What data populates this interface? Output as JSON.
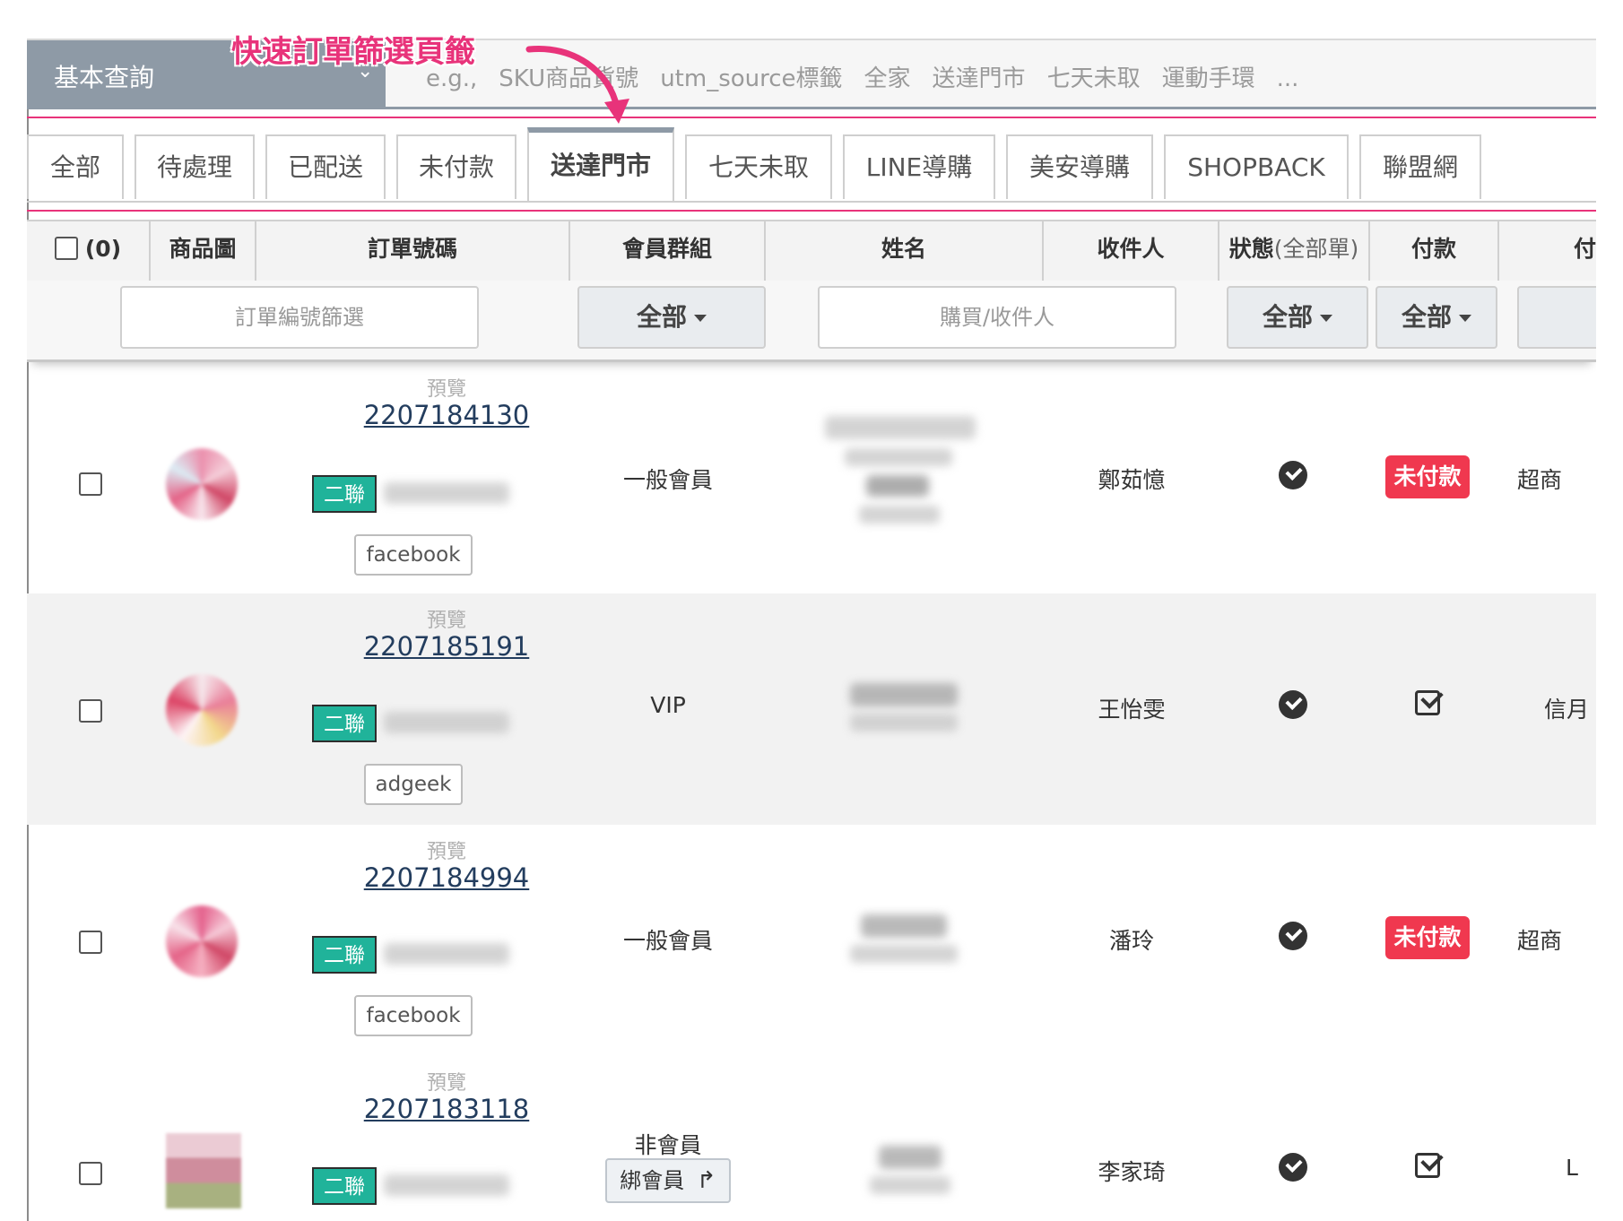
{
  "search": {
    "query_type": "基本查詢",
    "hints": [
      "e.g.,",
      "SKU商品貨號",
      "utm_source標籤",
      "全家",
      "送達門市",
      "七天未取",
      "運動手環",
      "..."
    ]
  },
  "annotation": "快速訂單篩選頁籤",
  "tabs": [
    {
      "label": "全部"
    },
    {
      "label": "待處理"
    },
    {
      "label": "已配送"
    },
    {
      "label": "未付款"
    },
    {
      "label": "送達門市"
    },
    {
      "label": "七天未取"
    },
    {
      "label": "LINE導購"
    },
    {
      "label": "美安導購"
    },
    {
      "label": "SHOPBACK"
    },
    {
      "label": "聯盟網"
    }
  ],
  "active_tab": "送達門市",
  "columns": {
    "select_count": "(0)",
    "image": "商品圖",
    "order_no": "訂單號碼",
    "member_group": "會員群組",
    "name": "姓名",
    "recipient": "收件人",
    "status": "狀態",
    "status_sub": "(全部單)",
    "payment": "付款",
    "next": "付"
  },
  "filters": {
    "order_placeholder": "訂單編號篩選",
    "member_group": "全部",
    "buyer_placeholder": "購買/收件人",
    "status": "全部",
    "payment": "全部"
  },
  "orders": [
    {
      "preview": "預覽",
      "order_no": "2207184130",
      "tag": "二聯",
      "source": "facebook",
      "member_group": "一般會員",
      "recipient": "鄭茹憶",
      "payment": "未付款",
      "shipping": "超商"
    },
    {
      "preview": "預覽",
      "order_no": "2207185191",
      "tag": "二聯",
      "source": "adgeek",
      "member_group": "VIP",
      "recipient": "王怡雯",
      "payment": "",
      "shipping": "信月"
    },
    {
      "preview": "預覽",
      "order_no": "2207184994",
      "tag": "二聯",
      "source": "facebook",
      "member_group": "一般會員",
      "recipient": "潘玲",
      "payment": "未付款",
      "shipping": "超商"
    },
    {
      "preview": "預覽",
      "order_no": "2207183118",
      "tag": "二聯",
      "source": "",
      "member_group": "非會員",
      "bind_label": "綁會員",
      "recipient": "李家琦",
      "payment": "",
      "shipping": "L"
    }
  ],
  "colors": {
    "accent": "#e8337a",
    "tag": "#20b39a",
    "unpaid": "#f0384f",
    "link": "#233d5e"
  }
}
